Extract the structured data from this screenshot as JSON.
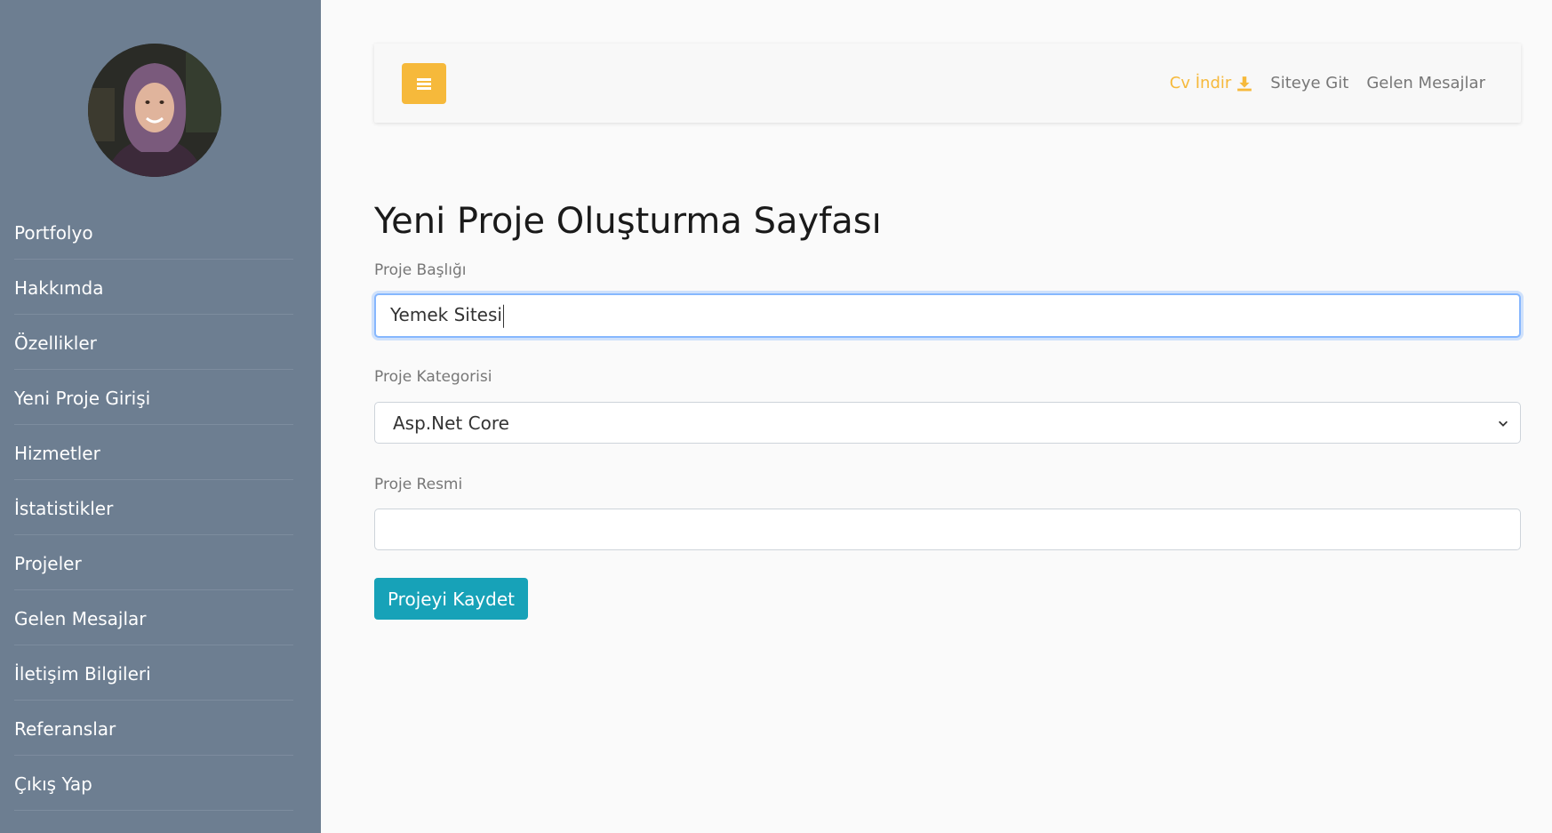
{
  "sidebar": {
    "items": [
      {
        "label": "Portfolyo"
      },
      {
        "label": "Hakkımda"
      },
      {
        "label": "Özellikler"
      },
      {
        "label": "Yeni Proje Girişi"
      },
      {
        "label": "Hizmetler"
      },
      {
        "label": "İstatistikler"
      },
      {
        "label": "Projeler"
      },
      {
        "label": "Gelen Mesajlar"
      },
      {
        "label": "İletişim Bilgileri"
      },
      {
        "label": "Referanslar"
      },
      {
        "label": "Çıkış Yap"
      }
    ]
  },
  "topbar": {
    "menu_icon": "hamburger-icon",
    "cv_label": "Cv İndir",
    "cv_icon": "download-icon",
    "site_label": "Siteye Git",
    "messages_label": "Gelen Mesajlar",
    "accent": "#f6b93b"
  },
  "form": {
    "title": "Yeni Proje Oluşturma Sayfası",
    "title_label": "Proje Başlığı",
    "title_value": "Yemek Sitesi",
    "category_label": "Proje Kategorisi",
    "category_value": "Asp.Net Core",
    "image_label": "Proje Resmi",
    "image_value": "",
    "save_label": "Projeyi Kaydet",
    "save_color": "#17a2b8"
  },
  "colors": {
    "sidebar_bg": "#6d7e91",
    "page_bg": "#fafafa"
  }
}
